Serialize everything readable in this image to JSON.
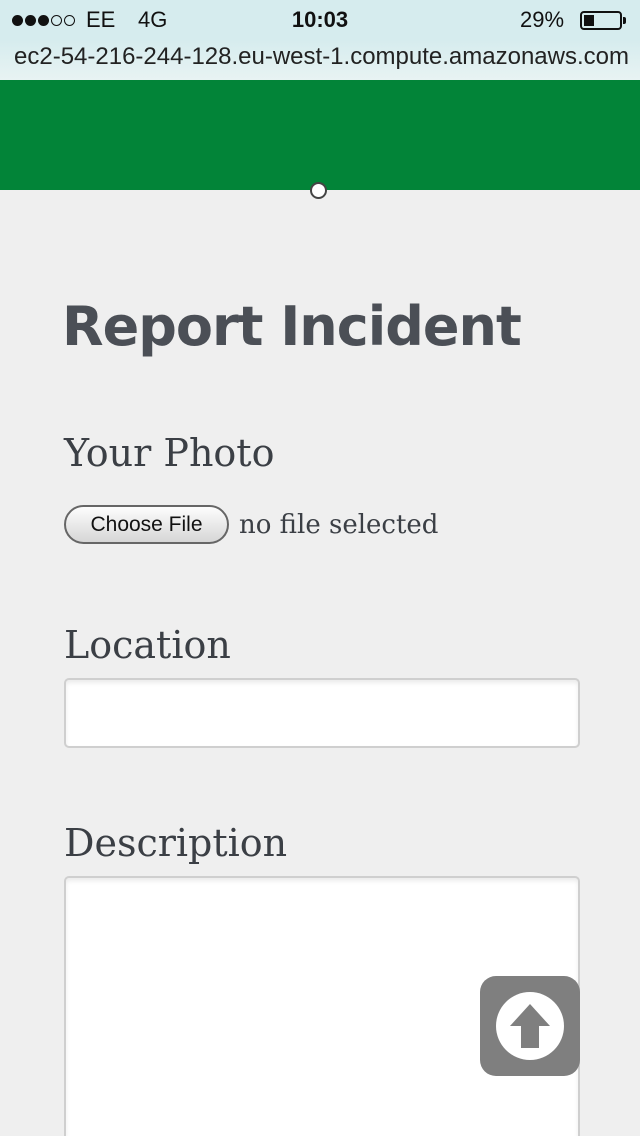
{
  "status_bar": {
    "carrier": "EE",
    "network": "4G",
    "time": "10:03",
    "battery_percent": "29%",
    "battery_level": 0.29,
    "signal_bars_filled": 3,
    "signal_bars_total": 5
  },
  "browser": {
    "url": "ec2-54-216-244-128.eu-west-1.compute.amazonaws.com"
  },
  "header": {
    "color": "#028438"
  },
  "form": {
    "title": "Report Incident",
    "photo": {
      "label": "Your Photo",
      "button_label": "Choose File",
      "status": "no file selected"
    },
    "location": {
      "label": "Location",
      "value": ""
    },
    "description": {
      "label": "Description",
      "value": ""
    }
  },
  "scroll_top_button": {
    "icon": "arrow-up-circle-icon"
  }
}
